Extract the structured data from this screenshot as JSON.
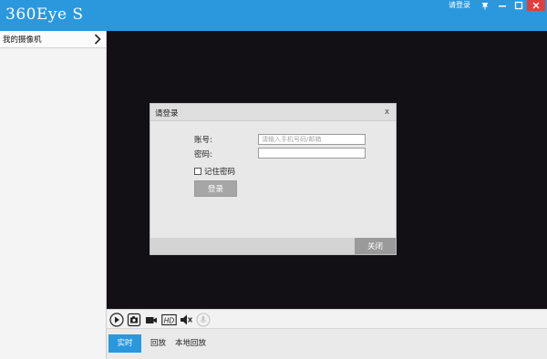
{
  "window": {
    "title": "360Eye S",
    "login_link": "请登录",
    "controls": {
      "pin": "pin-icon",
      "minimize": "minimize-icon",
      "maximize": "maximize-icon",
      "close": "close-icon"
    }
  },
  "sidebar": {
    "items": [
      {
        "label": "我的摄像机",
        "icon": "chevron-right-icon"
      }
    ]
  },
  "player_controls": [
    {
      "name": "play-icon"
    },
    {
      "name": "camera-icon"
    },
    {
      "name": "video-record-icon"
    },
    {
      "name": "hd-icon",
      "label": "HD"
    },
    {
      "name": "mute-icon"
    },
    {
      "name": "talk-icon"
    }
  ],
  "tabs": [
    {
      "label": "实时",
      "active": true
    },
    {
      "label": "回放",
      "active": false
    },
    {
      "label": "本地回放",
      "active": false
    }
  ],
  "dialog": {
    "title": "请登录",
    "close_glyph": "x",
    "account_label": "账号:",
    "account_placeholder": "请输入手机号码/邮箱",
    "account_value": "",
    "password_label": "密码:",
    "password_value": "",
    "remember_label": "记住密码",
    "remember_checked": false,
    "login_button": "登录",
    "close_button": "关闭"
  },
  "colors": {
    "accent": "#2b98de",
    "video_bg": "#121015",
    "close_red": "#e53c3c"
  }
}
